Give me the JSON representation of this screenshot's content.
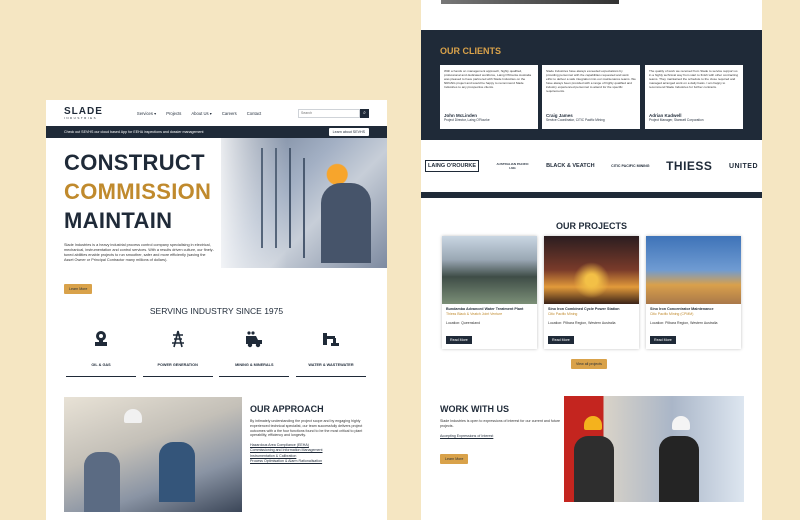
{
  "nav": {
    "logo_main": "SLADE",
    "logo_sub": "INDUSTRIES",
    "items": [
      "Services ▾",
      "Projects",
      "About Us ▾",
      "Careers",
      "Contact"
    ],
    "search_placeholder": "Search"
  },
  "banner": {
    "text": "Check out SEVHS our cloud based App for EEHA inspections and dossier management",
    "button": "Learn about SEVHS"
  },
  "hero": {
    "line1": "CONSTRUCT",
    "line2": "COMMISSION",
    "line3": "MAINTAIN",
    "body": "Slade Industries is a heavy industrial process control company specialising in electrical, mechanical, instrumentation and control services. With a results driven culture, our finely-tuned abilities enable projects to run smoother, safer and more efficiently (saving the Asset Owner or Principal Contractor many millions of dollars).",
    "button": "Learn More"
  },
  "serving": {
    "title": "SERVING INDUSTRY SINCE 1975",
    "industries": [
      "OIL & GAS",
      "POWER GENERATION",
      "MINING & MINERALS",
      "WATER & WASTEWATER"
    ]
  },
  "approach": {
    "title": "OUR APPROACH",
    "body": "By intimately understanding the project scope and by engaging highly experienced technical specialist, our team successfully delivers project outcomes with a the four functions found to be the most critical to plant operability, efficiency and longevity.",
    "links": [
      "Hazardous Area Compliance (EEHA)",
      "Commissioning and Information Management",
      "Instrumentation & Calibration",
      "Process Optimisation & Alarm Rationalisation"
    ]
  },
  "clients": {
    "title": "OUR CLIENTS",
    "testimonials": [
      {
        "quote": "With a hands on management approach, highly qualified, professional and dedicated workforce, Laing O'Rourke Australia was pleased to have partnered with Slade Industries on the NRGNG project and would be happy to recommend Slade Industries to any prospective clients.",
        "name": "John McLinden",
        "role": "Project Director, Laing O'Rourke"
      },
      {
        "quote": "Slade Industries have always exceeded expectations by providing personnel with the capabilities requested and work ethic to deliver a safe integration into our maintenance teams. We have always been provided with a range of highly qualified and industry experienced personnel to attend for the specific requirements.",
        "name": "Craig James",
        "role": "Service Coordinator, CITIC Pacific Mining"
      },
      {
        "quote": "The quality of work we received from Slade to service support us in a highly technical way from start to finish with other contracting teams. They maintained the schedule to the close required and managed arranged work on a daily basis. I am happy to recommend Slade Industries for further contracts.",
        "name": "Adrian Kadwell",
        "role": "Project Manager, Stanwell Corporation"
      }
    ]
  },
  "logos": [
    "LAING O'ROURKE",
    "AUSTRALIAN PACIFIC LNG",
    "BLACK & VEATCH",
    "CITIC PACIFIC MINING",
    "THIESS",
    "UNITED"
  ],
  "projects": {
    "title": "OUR PROJECTS",
    "items": [
      {
        "title": "Bundamba Advanced Water Treatment Plant",
        "client": "Thiess Black & Veatch Joint Venture",
        "location": "Location: Queensland",
        "button": "Read More"
      },
      {
        "title": "Sino Iron Combined Cycle Power Station",
        "client": "Citic Pacific Mining",
        "location": "Location: Pilbara Region, Western Australia",
        "button": "Read More"
      },
      {
        "title": "Sino Iron Concentrator Maintenance",
        "client": "Citic Pacific Mining (CPMM)",
        "location": "Location: Pilbara Region, Western Australia",
        "button": "Read More"
      }
    ],
    "view_all": "View all projects"
  },
  "work": {
    "title": "WORK WITH US",
    "body": "Slade Industries is open to expressions of interest for our current and future projects.",
    "link": "Accepting Expressions of Interest",
    "button": "Learn More"
  },
  "colors": {
    "navy": "#1f2a38",
    "gold": "#d9a24a",
    "background": "#f5e6c2"
  }
}
